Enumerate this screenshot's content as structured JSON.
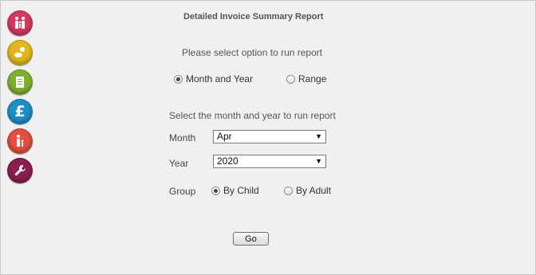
{
  "sidebar": {
    "items": [
      {
        "icon": "family-icon",
        "color": "#d8375f"
      },
      {
        "icon": "baby-icon",
        "color": "#e0b81c"
      },
      {
        "icon": "document-icon",
        "color": "#7fb130"
      },
      {
        "icon": "pound-icon",
        "color": "#1e8fc6"
      },
      {
        "icon": "adult-child-icon",
        "color": "#e2503f"
      },
      {
        "icon": "wrench-icon",
        "color": "#8b1f4f"
      }
    ],
    "pound_symbol": "£"
  },
  "report": {
    "title": "Detailed Invoice Summary Report",
    "prompt": "Please select option to run report",
    "options": {
      "month_year_label": "Month and Year",
      "range_label": "Range",
      "selected": "month_year"
    },
    "sub_prompt": "Select the month and year to run report",
    "month": {
      "label": "Month",
      "value": "Apr"
    },
    "year": {
      "label": "Year",
      "value": "2020"
    },
    "group": {
      "label": "Group",
      "by_child_label": "By Child",
      "by_adult_label": "By Adult",
      "selected": "by_child"
    },
    "go_label": "Go"
  }
}
